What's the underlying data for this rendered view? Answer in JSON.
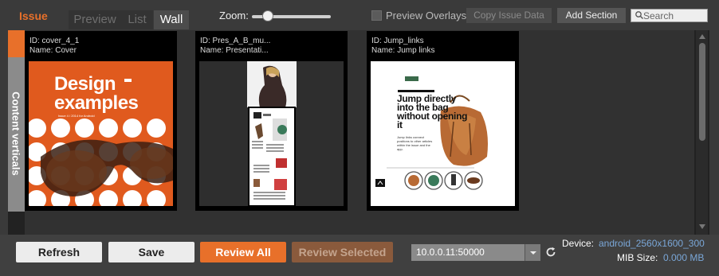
{
  "header": {
    "section_label": "Issue",
    "tabs": [
      {
        "label": "Preview"
      },
      {
        "label": "List"
      },
      {
        "label": "Wall"
      }
    ],
    "active_tab": "Wall",
    "zoom_label": "Zoom:",
    "zoom_level": 0.2,
    "preview_overlays_label": "Preview Overlays",
    "preview_overlays_checked": false,
    "copy_issue_data_label": "Copy Issue Data",
    "add_section_label": "Add Section",
    "search_placeholder": "Search"
  },
  "sidebar": {
    "vertical_tab_label": "Content verticals"
  },
  "cards": [
    {
      "id_text": "ID: cover_4_1",
      "name_text": "Name: Cover",
      "thumb": {
        "title": "Design examples",
        "title_line1": "Design",
        "title_line2": "examples",
        "subtitle": "Issue 4 / 2014 for Android"
      }
    },
    {
      "id_text": "ID: Pres_A_B_mu...",
      "name_text": "Name: Presentati..."
    },
    {
      "id_text": "ID: Jump_links",
      "name_text": "Name: Jump links",
      "thumb": {
        "title": "Jump directly into the bag without opening it",
        "subtitle": "Jump links connect positions to other articles within the issue and the app."
      }
    }
  ],
  "footer": {
    "refresh_label": "Refresh",
    "save_label": "Save",
    "review_all_label": "Review All",
    "review_selected_label": "Review Selected",
    "ip_address": "10.0.0.11:50000",
    "device_label": "Device:",
    "device_value": "android_2560x1600_300",
    "mib_size_label": "MIB Size:",
    "mib_size_value": "0.000 MB"
  },
  "colors": {
    "accent": "#e8702a",
    "info_blue": "#7aa7d8"
  }
}
